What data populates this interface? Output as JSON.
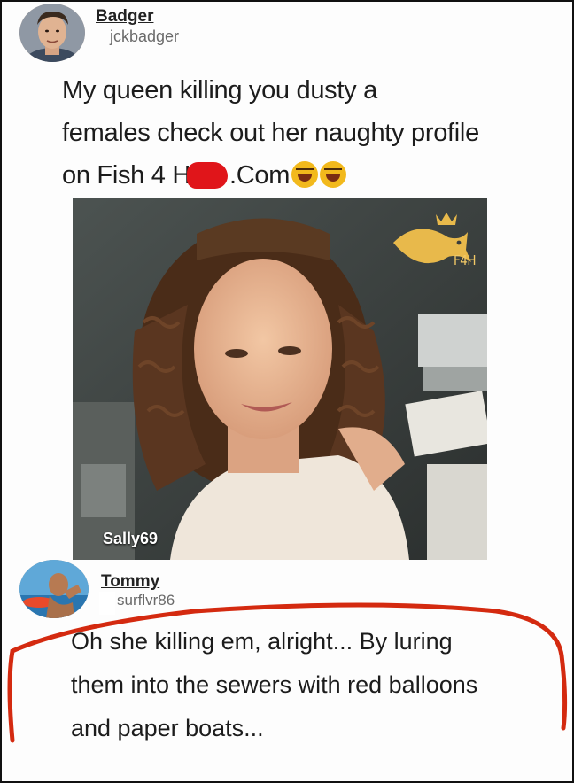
{
  "post": {
    "author": {
      "name": "Badger",
      "handle": "jckbadger"
    },
    "text": {
      "line1": "My queen killing you dusty a",
      "line2": "females check out her naughty profile",
      "line3_start": "on Fish 4 H",
      "line3_end": ".Com"
    },
    "emoji": "rolling-on-floor-laughing-icon"
  },
  "photo": {
    "caption": "Sally69",
    "watermark_text": "F4H",
    "watermark_icon": "crowned-fish-icon",
    "watermark_color": "#e8b94b"
  },
  "reply": {
    "author": {
      "name": "Tommy",
      "handle": "surflvr86"
    },
    "text": {
      "line1": "Oh she killing em, alright... By luring",
      "line2": "them into the sewers with red balloons",
      "line3": "and paper boats..."
    }
  },
  "annotation": {
    "color": "#d42a10"
  }
}
